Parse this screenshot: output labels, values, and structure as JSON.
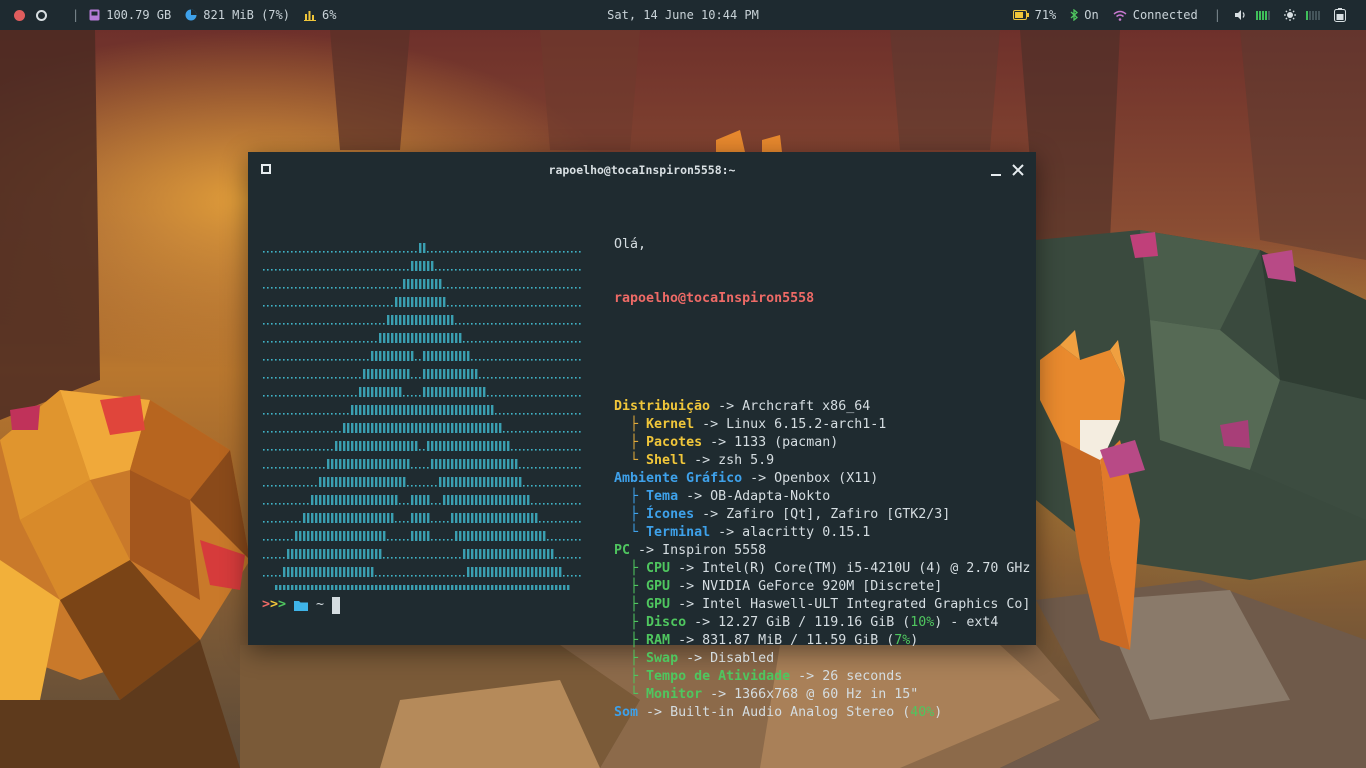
{
  "topbar": {
    "disk": "100.79 GB",
    "memory": "821 MiB (7%)",
    "cpu": "6%",
    "datetime": "Sat, 14 June 10:44 PM",
    "battery": "71%",
    "bluetooth": "On",
    "wifi": "Connected",
    "separator": "|",
    "volume_level": 0.8,
    "brightness_level": 0.1,
    "colors": {
      "close_dot": "#e05d5d",
      "disk": "#b57bd6",
      "memory": "#3ea1ea",
      "cpu": "#f0c63a",
      "battery": "#f0c63a",
      "bluetooth": "#4fc65f",
      "wifi": "#c779d0"
    }
  },
  "terminal": {
    "title": "rapoelho@tocaInspiron5558:~",
    "greeting": "Olá,",
    "user_host": "rapoelho@tocaInspiron5558",
    "arrow": "->",
    "sections": [
      {
        "key": "Distribuição",
        "value": "Archcraft x86_64",
        "color": "yellow",
        "children": [
          {
            "branch": "├",
            "key": "Kernel",
            "value": "Linux 6.15.2-arch1-1"
          },
          {
            "branch": "├",
            "key": "Pacotes",
            "value": "1133 (pacman)"
          },
          {
            "branch": "└",
            "key": "Shell",
            "value": "zsh 5.9"
          }
        ]
      },
      {
        "key": "Ambiente Gráfico",
        "value": "Openbox (X11)",
        "color": "blue",
        "children": [
          {
            "branch": "├",
            "key": "Tema",
            "value": "OB-Adapta-Nokto"
          },
          {
            "branch": "├",
            "key": "Ícones",
            "value": "Zafiro [Qt], Zafiro [GTK2/3]"
          },
          {
            "branch": "└",
            "key": "Terminal",
            "value": "alacritty 0.15.1"
          }
        ]
      },
      {
        "key": "PC",
        "value": "Inspiron 5558",
        "color": "green",
        "children": [
          {
            "branch": "├",
            "key": "CPU",
            "value": "Intel(R) Core(TM) i5-4210U (4) @ 2.70 GHz"
          },
          {
            "branch": "├",
            "key": "GPU",
            "value": "NVIDIA GeForce 920M [Discrete]"
          },
          {
            "branch": "├",
            "key": "GPU",
            "value": "Intel Haswell-ULT Integrated Graphics Co]"
          },
          {
            "branch": "├",
            "key": "Disco",
            "value_pre": "12.27 GiB / 119.16 GiB (",
            "value_hl": "10%",
            "value_post": ") - ext4"
          },
          {
            "branch": "├",
            "key": "RAM",
            "value_pre": "831.87 MiB / 11.59 GiB (",
            "value_hl": "7%",
            "value_post": ")"
          },
          {
            "branch": "├",
            "key": "Swap",
            "value": "Disabled"
          },
          {
            "branch": "├",
            "key": "Tempo de Atividade",
            "value": "26 seconds"
          },
          {
            "branch": "└",
            "key": "Monitor",
            "value": "1366x768 @ 60 Hz in 15\""
          }
        ]
      },
      {
        "key": "Som",
        "value_pre": "Built-in Audio Analog Stereo (",
        "value_hl": "40%",
        "value_post": ")",
        "color": "blue",
        "children": []
      }
    ],
    "prompt": {
      "chevrons": ">>>",
      "path": "~"
    }
  }
}
